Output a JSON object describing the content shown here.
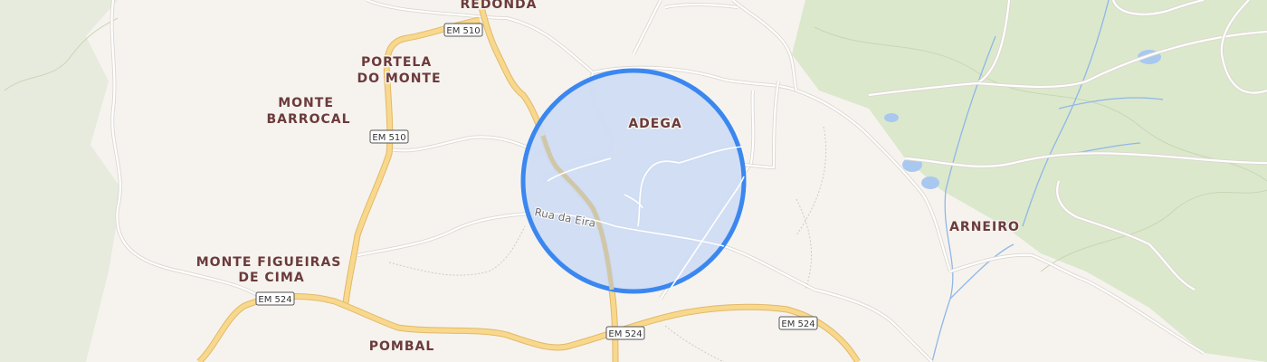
{
  "map": {
    "places": [
      {
        "id": "redonda",
        "label": "REDONDA"
      },
      {
        "id": "portela",
        "lines": [
          "PORTELA",
          "DO MONTE"
        ]
      },
      {
        "id": "monte-barrocal",
        "lines": [
          "MONTE",
          "BARROCAL"
        ]
      },
      {
        "id": "adega",
        "label": "ADEGA"
      },
      {
        "id": "arneiro",
        "label": "ARNEIRO"
      },
      {
        "id": "monte-figueiras",
        "lines": [
          "MONTE FIGUEIRAS",
          "DE CIMA"
        ]
      },
      {
        "id": "pombal",
        "label": "POMBAL"
      }
    ],
    "road_shields": [
      "EM 510",
      "EM 510",
      "EM 524",
      "EM 524",
      "EM 524"
    ],
    "street_label": "Rua da Eira",
    "colors": {
      "background": "#f6f3ef",
      "forest": "#dbe8cc",
      "main_road": "#f8d88c",
      "selection_fill": "#cddcf4",
      "selection_stroke": "#3b87f0",
      "label": "#6b3b3b",
      "water": "#8fb7e8"
    }
  }
}
